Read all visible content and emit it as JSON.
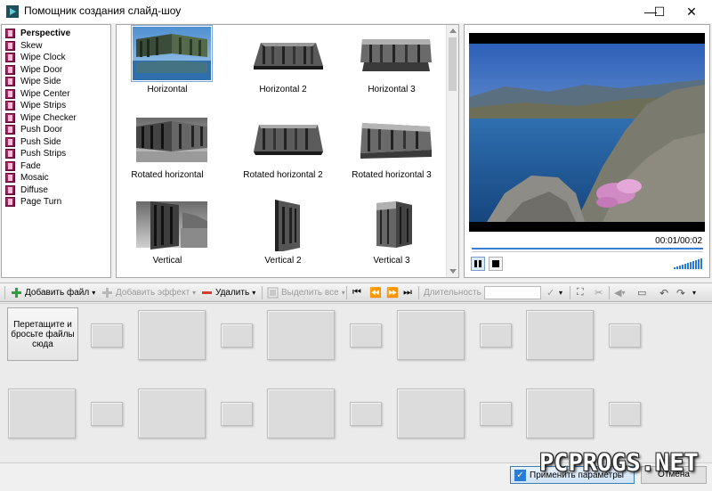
{
  "window": {
    "title": "Помощник создания слайд-шоу",
    "minimize": "—",
    "maximize": "☐",
    "close": "✕"
  },
  "effects": {
    "items": [
      {
        "label": "Perspective",
        "selected": true
      },
      {
        "label": "Skew"
      },
      {
        "label": "Wipe Clock"
      },
      {
        "label": "Wipe Door"
      },
      {
        "label": "Wipe Side"
      },
      {
        "label": "Wipe Center"
      },
      {
        "label": "Wipe Strips"
      },
      {
        "label": "Wipe Checker"
      },
      {
        "label": "Push Door"
      },
      {
        "label": "Push Side"
      },
      {
        "label": "Push Strips"
      },
      {
        "label": "Fade"
      },
      {
        "label": "Mosaic"
      },
      {
        "label": "Diffuse"
      },
      {
        "label": "Page Turn"
      }
    ]
  },
  "transitions": [
    {
      "label": "Horizontal",
      "selected": true
    },
    {
      "label": "Horizontal 2"
    },
    {
      "label": "Horizontal 3"
    },
    {
      "label": "Rotated horizontal"
    },
    {
      "label": "Rotated horizontal 2"
    },
    {
      "label": "Rotated horizontal 3"
    },
    {
      "label": "Vertical"
    },
    {
      "label": "Vertical 2"
    },
    {
      "label": "Vertical 3"
    }
  ],
  "preview": {
    "time": "00:01/00:02"
  },
  "toolbar": {
    "add_file": "Добавить файл",
    "add_effect": "Добавить эффект",
    "delete": "Удалить",
    "select_all": "Выделить все",
    "duration": "Длительность"
  },
  "storyboard": {
    "drop_hint": "Перетащите и бросьте файлы сюда"
  },
  "footer": {
    "apply": "Применить параметры",
    "cancel": "Отмена"
  },
  "watermark": "PCPROGS.NET",
  "colors": {
    "accent": "#3b7fd1",
    "effect_icon": "#c3306a",
    "delete_icon": "#d93a2a",
    "add_icon": "#2e9e3e"
  }
}
